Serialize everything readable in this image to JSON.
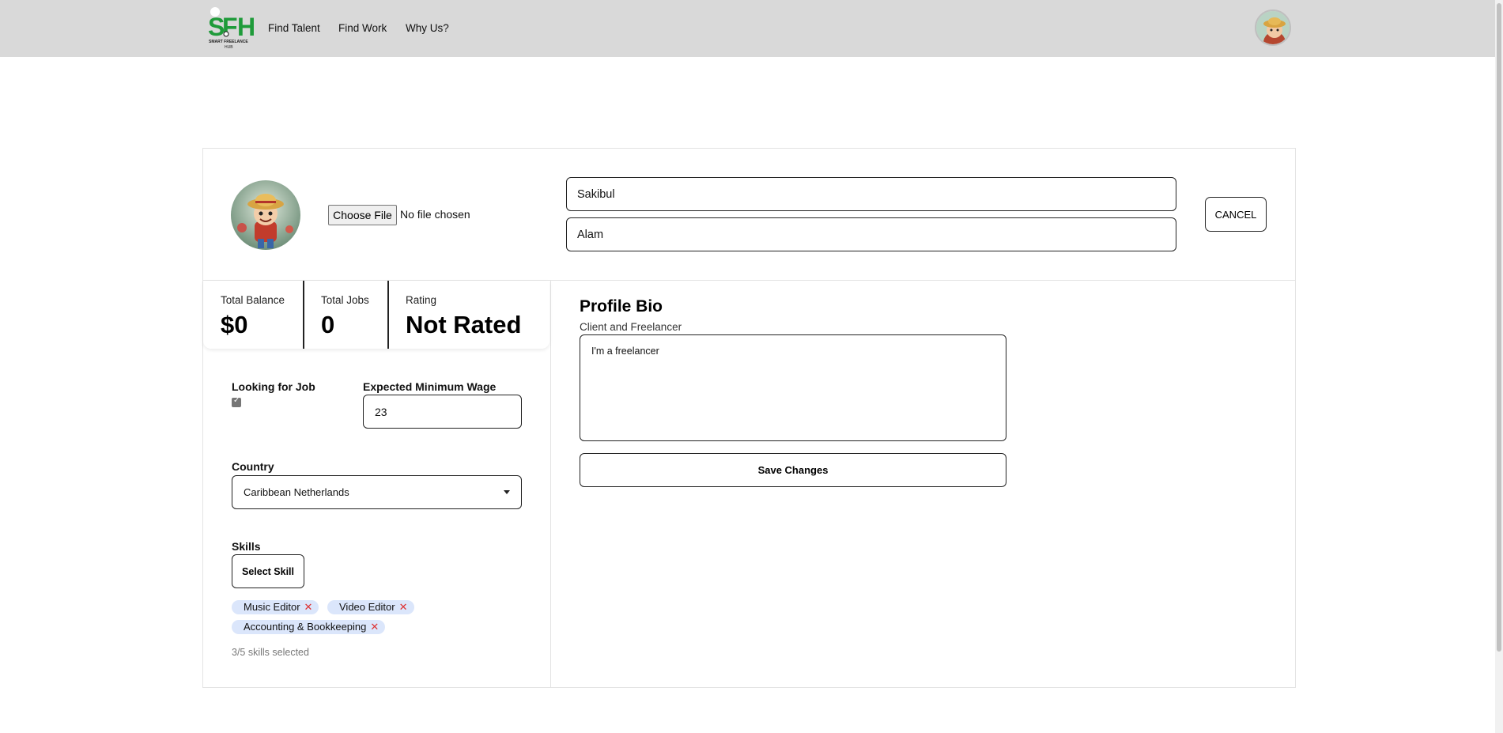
{
  "header": {
    "logo_text": "SFH",
    "logo_subtext": "SMART FREELANCE HUB",
    "nav": [
      "Find Talent",
      "Find Work",
      "Why Us?"
    ],
    "brand_color": "#1f9b3a"
  },
  "profile": {
    "choose_file_label": "Choose File",
    "no_file_text": "No file chosen",
    "first_name": "Sakibul",
    "last_name": "Alam",
    "cancel_label": "CANCEL"
  },
  "stats": {
    "balance_label": "Total Balance",
    "balance_value": "$0",
    "jobs_label": "Total Jobs",
    "jobs_value": "0",
    "rating_label": "Rating",
    "rating_value": "Not Rated"
  },
  "form": {
    "looking_label": "Looking for Job",
    "looking_checked": true,
    "wage_label": "Expected Minimum Wage",
    "wage_value": "23",
    "country_label": "Country",
    "country_value": "Caribbean Netherlands",
    "skills_label": "Skills",
    "select_skill_label": "Select Skill",
    "skills": [
      "Music Editor",
      "Video Editor",
      "Accounting & Bookkeeping"
    ],
    "skills_count": "3/5 skills selected",
    "chip_color": "#dbe6fb"
  },
  "bio": {
    "title": "Profile Bio",
    "subtitle": "Client and Freelancer",
    "text": "I'm a freelancer",
    "save_label": "Save Changes"
  }
}
